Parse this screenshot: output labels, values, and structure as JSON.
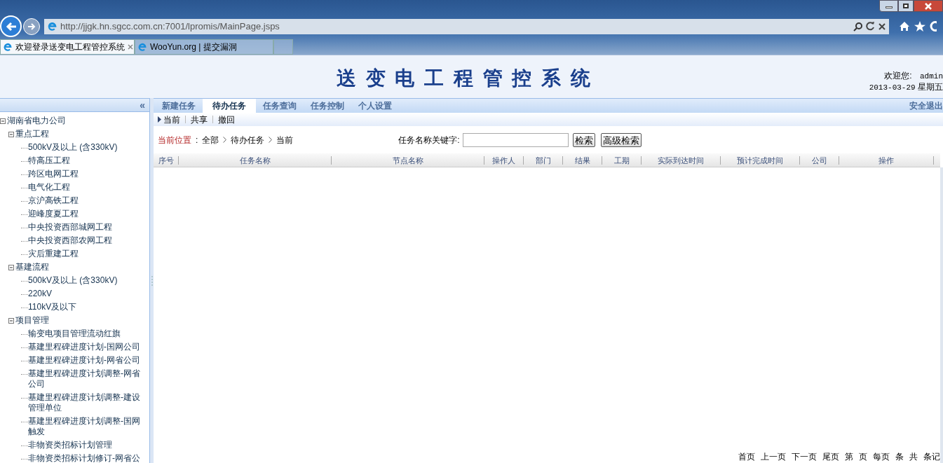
{
  "browser": {
    "url": "http://jjgk.hn.sgcc.com.cn:7001/lpromis/MainPage.jsps",
    "tabs": [
      {
        "label": "欢迎登录送变电工程管控系统",
        "selected": true
      },
      {
        "label": "WooYun.org | 提交漏洞",
        "selected": false
      }
    ]
  },
  "header": {
    "title": "送 变 电 工 程 管 控 系 统",
    "welcome": "欢迎您:",
    "user": "admin",
    "date": "2013-03-29",
    "weekday": "星期五"
  },
  "sidebar": {
    "collapse": "«",
    "tree": [
      {
        "label": "湖南省电力公司",
        "expanded": true,
        "children": [
          {
            "label": "重点工程",
            "expanded": true,
            "children": [
              {
                "label": "500kV及以上 (含330kV)"
              },
              {
                "label": "特高压工程"
              },
              {
                "label": "跨区电网工程"
              },
              {
                "label": "电气化工程"
              },
              {
                "label": "京沪高铁工程"
              },
              {
                "label": "迎峰度夏工程"
              },
              {
                "label": "中央投资西部城网工程"
              },
              {
                "label": "中央投资西部农网工程"
              },
              {
                "label": "灾后重建工程"
              }
            ]
          },
          {
            "label": "基建流程",
            "expanded": true,
            "children": [
              {
                "label": "500kV及以上 (含330kV)"
              },
              {
                "label": "220kV"
              },
              {
                "label": "110kV及以下"
              }
            ]
          },
          {
            "label": "项目管理",
            "expanded": true,
            "children": [
              {
                "label": "输变电项目管理流动红旗"
              },
              {
                "label": "基建里程碑进度计划-国网公司"
              },
              {
                "label": "基建里程碑进度计划-网省公司"
              },
              {
                "label": "基建里程碑进度计划调整-网省公司"
              },
              {
                "label": "基建里程碑进度计划调整-建设管理单位"
              },
              {
                "label": "基建里程碑进度计划调整-国网触发"
              },
              {
                "label": "非物资类招标计划管理"
              },
              {
                "label": "非物资类招标计划修订-网省公"
              }
            ]
          }
        ]
      }
    ]
  },
  "nav": {
    "tabs": [
      {
        "label": "新建任务",
        "selected": false
      },
      {
        "label": "待办任务",
        "selected": true
      },
      {
        "label": "任务查询",
        "selected": false
      },
      {
        "label": "任务控制",
        "selected": false
      },
      {
        "label": "个人设置",
        "selected": false
      }
    ],
    "logout": "安全退出"
  },
  "subnav": [
    {
      "label": "当前",
      "selected": true
    },
    {
      "label": "共享",
      "selected": false
    },
    {
      "label": "撤回",
      "selected": false
    }
  ],
  "breadcrumb": {
    "label": "当前位置",
    "separator": ":",
    "items": [
      "全部",
      "待办任务",
      "当前"
    ]
  },
  "search": {
    "label": "任务名称关键字:",
    "buttons": [
      "检索",
      "高级检索"
    ]
  },
  "table": {
    "columns": [
      "序号",
      "任务名称",
      "节点名称",
      "操作人",
      "部门",
      "结果",
      "工期",
      "实际到达时间",
      "预计完成时间",
      "公司",
      "操作"
    ]
  },
  "pager": [
    "首页",
    "上一页",
    "下一页",
    "尾页",
    "第",
    "页",
    "每页",
    "条",
    "共",
    "条记"
  ]
}
